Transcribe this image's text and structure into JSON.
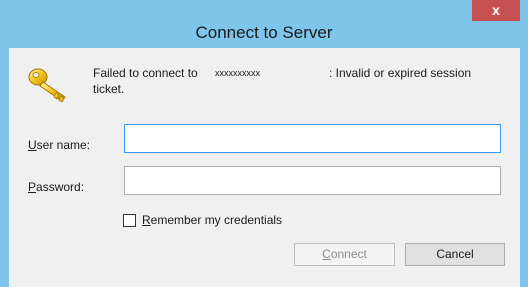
{
  "window": {
    "title": "Connect to Server",
    "close_label": "x"
  },
  "message": {
    "prefix": "Failed to connect to",
    "host": "xxxxxxxxxx",
    "reason": ": Invalid or expired session",
    "continuation": "ticket."
  },
  "form": {
    "username_label_accel": "U",
    "username_label_rest": "ser name:",
    "username_value": "",
    "password_label_accel": "P",
    "password_label_rest": "assword:",
    "password_value": "",
    "remember_accel": "R",
    "remember_rest": "emember my credentials",
    "remember_checked": false
  },
  "buttons": {
    "connect_accel": "C",
    "connect_rest": "onnect",
    "cancel_label": "Cancel"
  },
  "icons": {
    "key": "key-icon"
  },
  "colors": {
    "titlebar": "#7fc4e9",
    "close": "#c75050",
    "focus_border": "#3399ff"
  }
}
